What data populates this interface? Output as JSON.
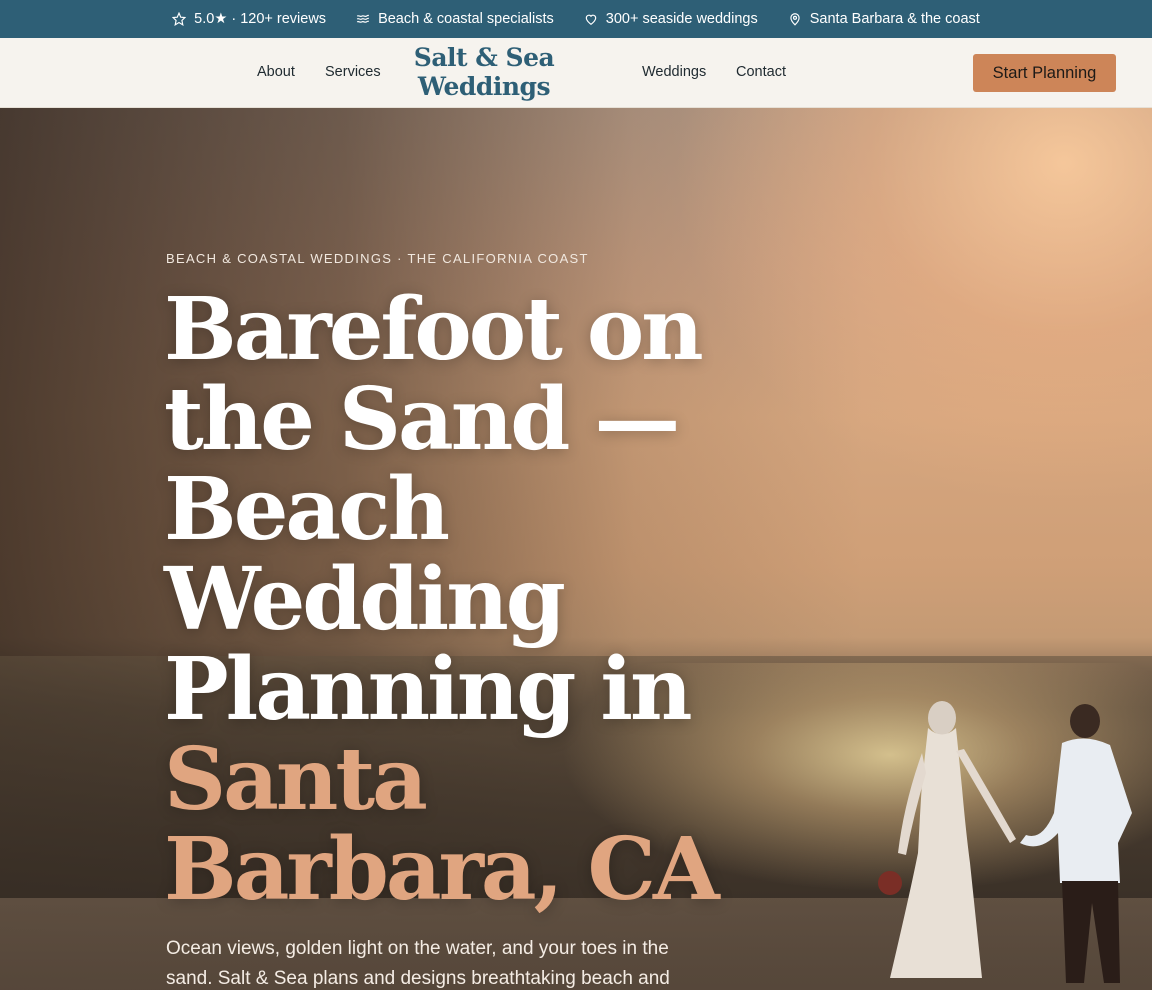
{
  "topbar": {
    "items": [
      {
        "icon": "star-icon",
        "label": "5.0★ · 120+ reviews"
      },
      {
        "icon": "waves-icon",
        "label": "Beach & coastal specialists"
      },
      {
        "icon": "heart-icon",
        "label": "300+ seaside weddings"
      },
      {
        "icon": "map-pin-icon",
        "label": "Santa Barbara & the coast"
      }
    ],
    "background": "#2e5f76"
  },
  "nav": {
    "links": [
      "About",
      "Services",
      "Weddings",
      "Contact"
    ],
    "logo_line1": "Salt & Sea",
    "logo_line2": "Weddings",
    "cta_label": "Start Planning"
  },
  "hero": {
    "eyebrow": "BEACH & COASTAL WEDDINGS · THE CALIFORNIA COAST",
    "headline_main": "Barefoot on the Sand — Beach Wedding Planning in",
    "headline_accent": "Santa Barbara, CA",
    "lede": "Ocean views, golden light on the water, and your toes in the sand. Salt & Sea plans and designs breathtaking beach and",
    "image": "couple-on-beach-at-sunset"
  },
  "colors": {
    "brand": "#2e5f76",
    "accent": "#cd8558",
    "headline_accent": "#e0a580",
    "nav_background": "#f6f3ee"
  }
}
